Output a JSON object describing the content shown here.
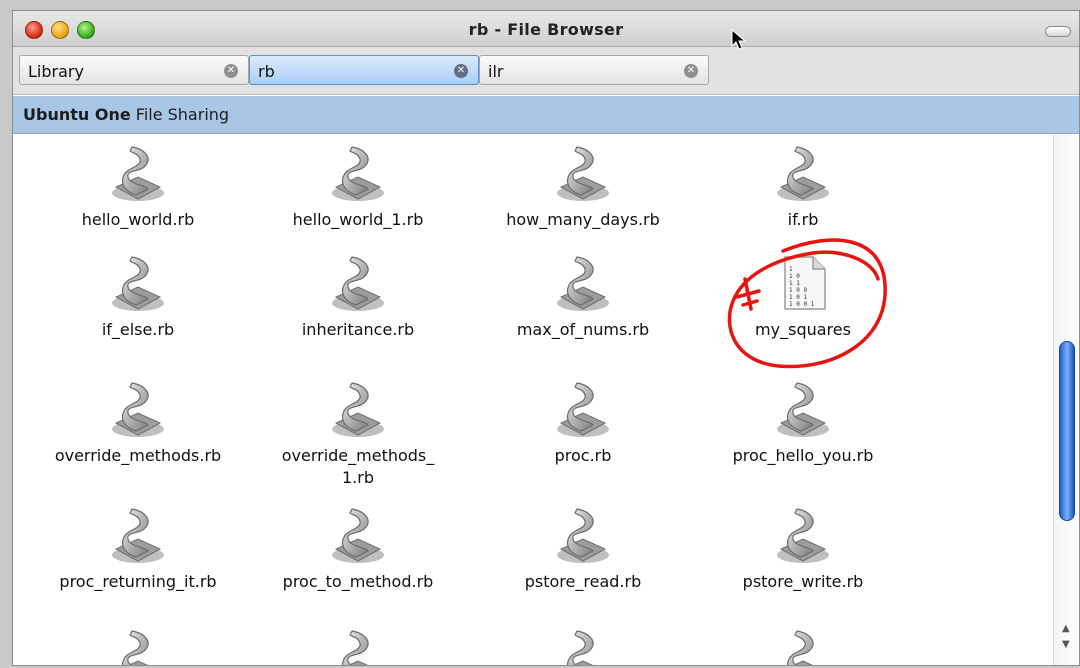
{
  "window": {
    "title": "rb - File Browser"
  },
  "tabs": [
    {
      "label": "Library",
      "active": false
    },
    {
      "label": "rb",
      "active": true
    },
    {
      "label": "ilr",
      "active": false
    }
  ],
  "location": {
    "bold": "Ubuntu One",
    "rest": " File Sharing"
  },
  "files": [
    {
      "label": "hello_world.rb",
      "icon": "ruby-script-icon"
    },
    {
      "label": "hello_world_1.rb",
      "icon": "ruby-script-icon"
    },
    {
      "label": "how_many_days.rb",
      "icon": "ruby-script-icon"
    },
    {
      "label": "if.rb",
      "icon": "ruby-script-icon"
    },
    {
      "label": "if_else.rb",
      "icon": "ruby-script-icon"
    },
    {
      "label": "inheritance.rb",
      "icon": "ruby-script-icon"
    },
    {
      "label": "max_of_nums.rb",
      "icon": "ruby-script-icon"
    },
    {
      "label": "my_squares",
      "icon": "binary-file-icon"
    },
    {
      "label": "override_methods.rb",
      "icon": "ruby-script-icon"
    },
    {
      "label": "override_methods_\n1.rb",
      "icon": "ruby-script-icon"
    },
    {
      "label": "proc.rb",
      "icon": "ruby-script-icon"
    },
    {
      "label": "proc_hello_you.rb",
      "icon": "ruby-script-icon"
    },
    {
      "label": "proc_returning_it.rb",
      "icon": "ruby-script-icon"
    },
    {
      "label": "proc_to_method.rb",
      "icon": "ruby-script-icon"
    },
    {
      "label": "pstore_read.rb",
      "icon": "ruby-script-icon"
    },
    {
      "label": "pstore_write.rb",
      "icon": "ruby-script-icon"
    },
    {
      "label": "",
      "icon": "ruby-script-icon"
    },
    {
      "label": "",
      "icon": "ruby-script-icon"
    },
    {
      "label": "",
      "icon": "ruby-script-icon"
    },
    {
      "label": "",
      "icon": "ruby-script-icon"
    }
  ],
  "annotation": {
    "color": "#e8140f",
    "icon": "red-circle-annotation"
  },
  "colors": {
    "location_bar": "#a8c6e6",
    "active_tab": "#a9cdf6",
    "scroll_thumb": "#3b7fe6"
  }
}
